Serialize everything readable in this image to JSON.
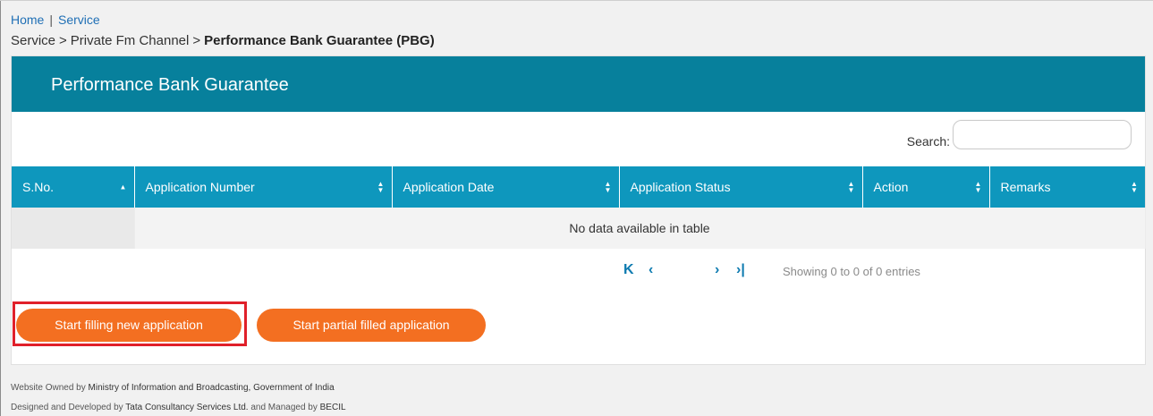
{
  "topnav": {
    "home": "Home",
    "separator": "|",
    "service": "Service"
  },
  "breadcrumb": {
    "items": [
      "Service",
      "Private Fm Channel"
    ],
    "separator": ">",
    "current": "Performance Bank Guarantee (PBG)"
  },
  "panel": {
    "title": "Performance Bank Guarantee"
  },
  "search": {
    "label": "Search:",
    "value": "",
    "placeholder": ""
  },
  "table": {
    "columns": [
      "S.No.",
      "Application Number",
      "Application Date",
      "Application Status",
      "Action",
      "Remarks"
    ],
    "empty_message": "No data available in table"
  },
  "pagination": {
    "first": "K",
    "prev": "‹",
    "next": "›",
    "last": "›|",
    "info": "Showing 0 to 0 of 0 entries"
  },
  "buttons": {
    "new_application": "Start filling new application",
    "partial_application": "Start partial filled application"
  },
  "footer": {
    "line1_prefix": "Website Owned by",
    "line1_owner": "Ministry of Information and Broadcasting, Government of India",
    "line2_prefix1": "Designed and Developed by",
    "line2_dev": "Tata Consultancy Services Ltd.",
    "line2_mid": "and Managed by",
    "line2_mgr": "BECIL"
  },
  "colors": {
    "header_bg": "#07809c",
    "table_header_bg": "#0e97bd",
    "button_bg": "#f36f21",
    "highlight": "#e0202a",
    "link": "#1f6fb5"
  }
}
